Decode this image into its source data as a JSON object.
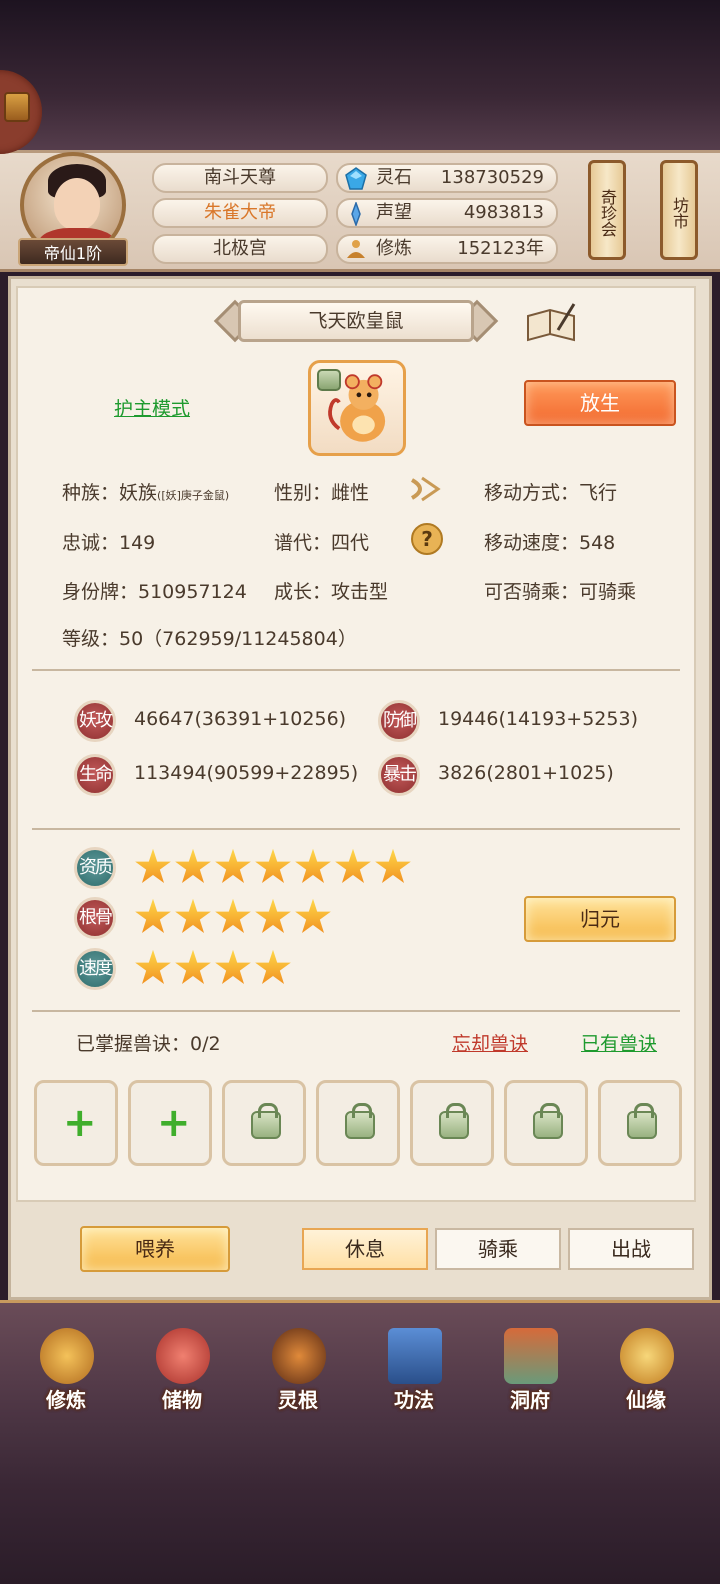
{
  "player": {
    "rank_badge": "帝仙1阶",
    "titles": [
      "南斗天尊",
      "朱雀大帝",
      "北极宫"
    ]
  },
  "resources": [
    {
      "label": "灵石",
      "value": "138730529",
      "icon": "spirit-stone-icon"
    },
    {
      "label": "声望",
      "value": "4983813",
      "icon": "prestige-icon"
    },
    {
      "label": "修炼",
      "value": "152123年",
      "icon": "meditation-icon"
    }
  ],
  "side_buttons": {
    "treasure_fair": "奇珍会",
    "market": "坊市"
  },
  "pet": {
    "name": "飞天欧皇鼠",
    "guard_mode": "护主模式",
    "release_button": "放生",
    "race_label": "种族：",
    "race_value": "妖族",
    "race_sub": "([妖]庚子金鼠)",
    "gender": "性别：雌性",
    "movement": "移动方式：飞行",
    "loyalty": "忠诚：149",
    "generation": "谱代：四代",
    "move_speed": "移动速度：548",
    "id_card": "身份牌：510957124",
    "growth": "成长：攻击型",
    "rideable": "可否骑乘：可骑乘",
    "level": "等级：50（762959/11245804）"
  },
  "stats": [
    {
      "badge": "妖攻",
      "value": "46647(36391+10256)"
    },
    {
      "badge": "防御",
      "value": "19446(14193+5253)"
    },
    {
      "badge": "生命",
      "value": "113494(90599+22895)"
    },
    {
      "badge": "暴击",
      "value": "3826(2801+1025)"
    }
  ],
  "ratings": [
    {
      "label": "资质",
      "stars": 7
    },
    {
      "label": "根骨",
      "stars": 5
    },
    {
      "label": "速度",
      "stars": 4
    }
  ],
  "reset_button": "归元",
  "skills": {
    "mastered": "已掌握兽诀：0/2",
    "forget": "忘却兽诀",
    "owned": "已有兽诀",
    "slots": [
      "plus",
      "plus",
      "lock",
      "lock",
      "lock",
      "lock",
      "lock"
    ]
  },
  "actions": {
    "feed": "喂养",
    "tabs": [
      "休息",
      "骑乘",
      "出战"
    ],
    "active_tab": "休息"
  },
  "nav": [
    "修炼",
    "储物",
    "灵根",
    "功法",
    "洞府",
    "仙缘"
  ],
  "colors": {
    "accent_orange": "#f2692f",
    "link_green": "#1e9a2e",
    "link_red": "#c0392b"
  }
}
